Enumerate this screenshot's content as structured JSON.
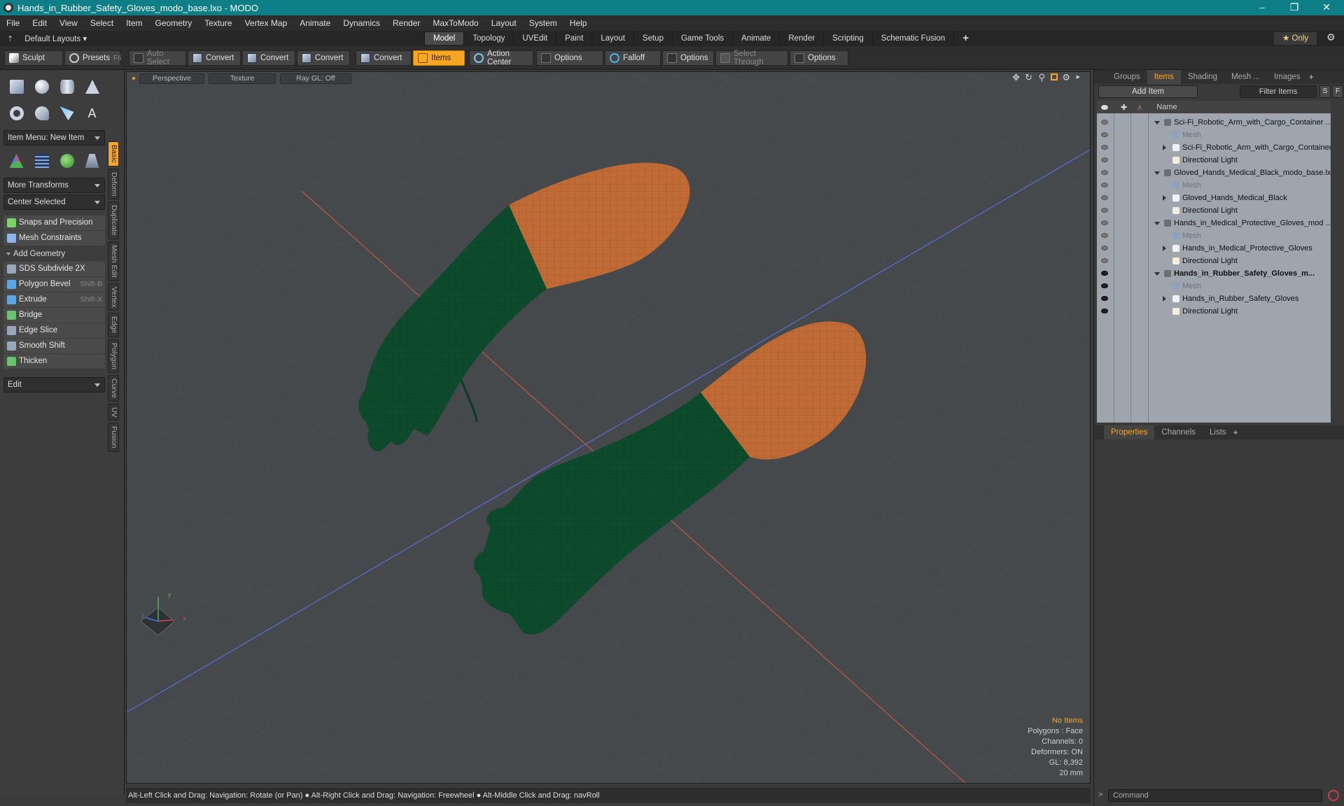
{
  "window": {
    "title": "Hands_in_Rubber_Safety_Gloves_modo_base.lxo - MODO",
    "minimize": "–",
    "maximize": "❐",
    "close": "✕"
  },
  "menu": [
    "File",
    "Edit",
    "View",
    "Select",
    "Item",
    "Geometry",
    "Texture",
    "Vertex Map",
    "Animate",
    "Dynamics",
    "Render",
    "MaxToModo",
    "Layout",
    "System",
    "Help"
  ],
  "layouts": {
    "default": "Default Layouts ▾",
    "tabs": [
      "Model",
      "Topology",
      "UVEdit",
      "Paint",
      "Layout",
      "Setup",
      "Game Tools",
      "Animate",
      "Render",
      "Scripting",
      "Schematic Fusion"
    ],
    "active_tab": "Model",
    "add": "+",
    "only": "★  Only",
    "gear": "⚙"
  },
  "toolbar": {
    "sculpt": "Sculpt",
    "presets": "Presets",
    "presets_key": "F6",
    "auto_select": "Auto Select",
    "convert": "Convert",
    "items": "Items",
    "action_center": "Action Center",
    "options": "Options",
    "falloff": "Falloff",
    "select_through": "Select Through"
  },
  "left": {
    "item_menu": "Item Menu: New Item",
    "more_transforms": "More Transforms",
    "center_selected": "Center Selected",
    "snaps": "Snaps and Precision",
    "mesh_constraints": "Mesh Constraints",
    "add_geometry": "Add Geometry",
    "tools": [
      {
        "label": "SDS Subdivide 2X",
        "key": ""
      },
      {
        "label": "Polygon Bevel",
        "key": "Shift-B"
      },
      {
        "label": "Extrude",
        "key": "Shift-X"
      },
      {
        "label": "Bridge",
        "key": ""
      },
      {
        "label": "Edge Slice",
        "key": ""
      },
      {
        "label": "Smooth Shift",
        "key": ""
      },
      {
        "label": "Thicken",
        "key": ""
      }
    ],
    "edit": "Edit",
    "vtabs": [
      "Basic",
      "Deform",
      "Duplicate",
      "Mesh Edit",
      "Vertex",
      "Edge",
      "Polygon",
      "Curve",
      "UV",
      "Fusion"
    ]
  },
  "viewport": {
    "perspective": "Perspective",
    "texture": "Texture",
    "raygl": "Ray GL: Off",
    "stats": [
      "No Items",
      "Polygons : Face",
      "Channels: 0",
      "Deformers: ON",
      "GL: 8,392",
      "20 mm"
    ],
    "axis_x": "x",
    "axis_y": "y",
    "axis_z": "z"
  },
  "status": "Alt-Left Click and Drag: Navigation: Rotate (or Pan) ● Alt-Right Click and Drag: Navigation: Freewheel ● Alt-Middle Click and Drag: navRoll",
  "right": {
    "tabs": [
      "Groups",
      "Items",
      "Shading",
      "Mesh ...",
      "Images"
    ],
    "active_tab": "Items",
    "add_item": "Add Item",
    "filter": "Filter Items",
    "s": "S",
    "f": "F",
    "name_col": "Name",
    "tree": [
      {
        "name": "Sci-Fi_Robotic_Arm_with_Cargo_Container ...",
        "kind": "scene",
        "depth": 0,
        "eye": false,
        "bold": false
      },
      {
        "name": "Mesh",
        "kind": "mesh",
        "depth": 1,
        "eye": false,
        "bold": false
      },
      {
        "name": "Sci-Fi_Robotic_Arm_with_Cargo_Container",
        "kind": "group",
        "depth": 1,
        "eye": false,
        "bold": false
      },
      {
        "name": "Directional Light",
        "kind": "light",
        "depth": 1,
        "eye": false,
        "bold": false
      },
      {
        "name": "Gloved_Hands_Medical_Black_modo_base.lxo",
        "kind": "scene",
        "depth": 0,
        "eye": false,
        "bold": false
      },
      {
        "name": "Mesh",
        "kind": "mesh",
        "depth": 1,
        "eye": false,
        "bold": false
      },
      {
        "name": "Gloved_Hands_Medical_Black",
        "kind": "group",
        "depth": 1,
        "eye": false,
        "bold": false
      },
      {
        "name": "Directional Light",
        "kind": "light",
        "depth": 1,
        "eye": false,
        "bold": false
      },
      {
        "name": "Hands_in_Medical_Protective_Gloves_mod ...",
        "kind": "scene",
        "depth": 0,
        "eye": false,
        "bold": false
      },
      {
        "name": "Mesh",
        "kind": "mesh",
        "depth": 1,
        "eye": false,
        "bold": false
      },
      {
        "name": "Hands_in_Medical_Protective_Gloves",
        "kind": "group",
        "depth": 1,
        "eye": false,
        "bold": false
      },
      {
        "name": "Directional Light",
        "kind": "light",
        "depth": 1,
        "eye": false,
        "bold": false
      },
      {
        "name": "Hands_in_Rubber_Safety_Gloves_m...",
        "kind": "scene",
        "depth": 0,
        "eye": true,
        "bold": true
      },
      {
        "name": "Mesh",
        "kind": "mesh",
        "depth": 1,
        "eye": true,
        "bold": false
      },
      {
        "name": "Hands_in_Rubber_Safety_Gloves",
        "kind": "group",
        "depth": 1,
        "eye": true,
        "bold": false
      },
      {
        "name": "Directional Light",
        "kind": "light",
        "depth": 1,
        "eye": true,
        "bold": false
      }
    ],
    "prop_tabs": [
      "Properties",
      "Channels",
      "Lists"
    ],
    "prop_active": "Properties",
    "prop_add": "+",
    "command_placeholder": "Command",
    "cmd_prompt": ">"
  },
  "colors": {
    "accent": "#f6a623",
    "title": "#0f7f87",
    "glove": "#0e4a2c",
    "arm": "#c06a35",
    "viewport": "#45494c"
  }
}
